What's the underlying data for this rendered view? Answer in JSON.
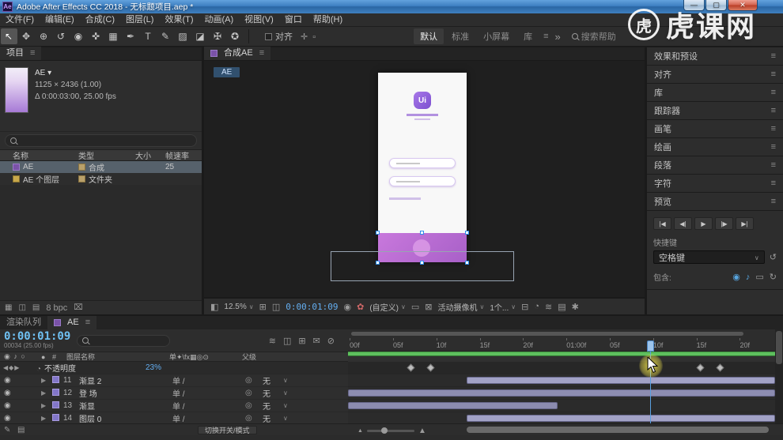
{
  "window": {
    "app_icon": "Ae",
    "title": "Adobe After Effects CC 2018 - 无标题项目.aep *",
    "minimize": "—",
    "maximize": "▢",
    "close": "✕"
  },
  "watermark": {
    "logo": "虎",
    "text": "虎课网"
  },
  "menubar": [
    "文件(F)",
    "编辑(E)",
    "合成(C)",
    "图层(L)",
    "效果(T)",
    "动画(A)",
    "视图(V)",
    "窗口",
    "帮助(H)"
  ],
  "toolbar": {
    "tools": [
      {
        "name": "selection-tool",
        "glyph": "↖",
        "active": true
      },
      {
        "name": "hand-tool",
        "glyph": "✥"
      },
      {
        "name": "zoom-tool",
        "glyph": "⊕"
      },
      {
        "name": "rotation-tool",
        "glyph": "↺"
      },
      {
        "name": "unified-camera-tool",
        "glyph": "◉"
      },
      {
        "name": "pan-behind-tool",
        "glyph": "✜"
      },
      {
        "name": "shape-tool",
        "glyph": "▦"
      },
      {
        "name": "pen-tool",
        "glyph": "✒"
      },
      {
        "name": "type-tool",
        "glyph": "T"
      },
      {
        "name": "brush-tool",
        "glyph": "✎"
      },
      {
        "name": "clone-stamp-tool",
        "glyph": "▨"
      },
      {
        "name": "eraser-tool",
        "glyph": "◪"
      },
      {
        "name": "roto-brush-tool",
        "glyph": "✠"
      },
      {
        "name": "puppet-pin-tool",
        "glyph": "✪"
      }
    ],
    "snap_label": "对齐",
    "misc_icons": "✛▫",
    "workspaces": [
      {
        "label": "默认",
        "active": true
      },
      {
        "label": "标准"
      },
      {
        "label": "小屏幕"
      },
      {
        "label": "库"
      }
    ],
    "overflow": "»",
    "search_help": "搜索帮助"
  },
  "project": {
    "tab": "项目",
    "item_name": "AE",
    "item_dims": "1125 × 2436 (1.00)",
    "item_duration": "Δ 0:00:03:00, 25.00 fps",
    "columns": {
      "name": "名称",
      "type": "类型",
      "size": "大小",
      "fps": "帧速率"
    },
    "rows": [
      {
        "name": "AE",
        "type": "合成",
        "size": "",
        "fps": "25",
        "selected": true
      },
      {
        "name": "AE 个图层",
        "type": "文件夹",
        "size": "",
        "fps": ""
      }
    ],
    "bpc": "8 bpc"
  },
  "comp": {
    "tab": "合成AE",
    "breadcrumb": "AE",
    "zoom": "12.5%",
    "timecode": "0:00:01:09",
    "resolution": "(自定义)",
    "camera": "活动摄像机",
    "views": "1个..."
  },
  "rightbar": {
    "sections": [
      "效果和预设",
      "对齐",
      "库",
      "跟踪器",
      "画笔",
      "绘画",
      "段落",
      "字符"
    ],
    "preview_title": "预览",
    "transport": [
      "|◀",
      "◀|",
      "▶",
      "|▶",
      "▶|"
    ],
    "shortcut_label": "快捷键",
    "shortcut_value": "空格键",
    "include_label": "包含:"
  },
  "timeline": {
    "tab_render_queue": "渲染队列",
    "tab_comp": "AE",
    "timecode": "0:00:01:09",
    "frame_info": "00034 (25.00 fps)",
    "header": {
      "av": "◉ ♪ ○",
      "dot": "●",
      "num": "#",
      "name": "图层名称",
      "switches": "单✦\\fx▦◎⊙",
      "parent": "父级"
    },
    "property_row": {
      "nav": "◀◆▶",
      "label": "不透明度",
      "value": "23%",
      "keyframes_pct": [
        14.8,
        19.4,
        82.6,
        87.2
      ]
    },
    "layers": [
      {
        "num": "11",
        "name": "渐显 2",
        "switches": "单 /",
        "parent": "无",
        "bar_start": 27.8,
        "bar_end": 100,
        "bright": true
      },
      {
        "num": "12",
        "name": "登 场",
        "switches": "单 /",
        "parent": "无",
        "bar_start": 0,
        "bar_end": 100,
        "bright": false
      },
      {
        "num": "13",
        "name": "渐显",
        "switches": "单 /",
        "parent": "无",
        "bar_start": 0,
        "bar_end": 49,
        "bright": false
      },
      {
        "num": "14",
        "name": "图层 0",
        "switches": "单 /",
        "parent": "无",
        "bar_start": 27.8,
        "bar_end": 100,
        "bright": true
      }
    ],
    "ruler": [
      "00f",
      "05f",
      "10f",
      "15f",
      "20f",
      "01:00f",
      "05f",
      "10f",
      "15f",
      "20f"
    ],
    "playhead_pct": 70.7,
    "toggle_button": "切换开关/模式"
  }
}
